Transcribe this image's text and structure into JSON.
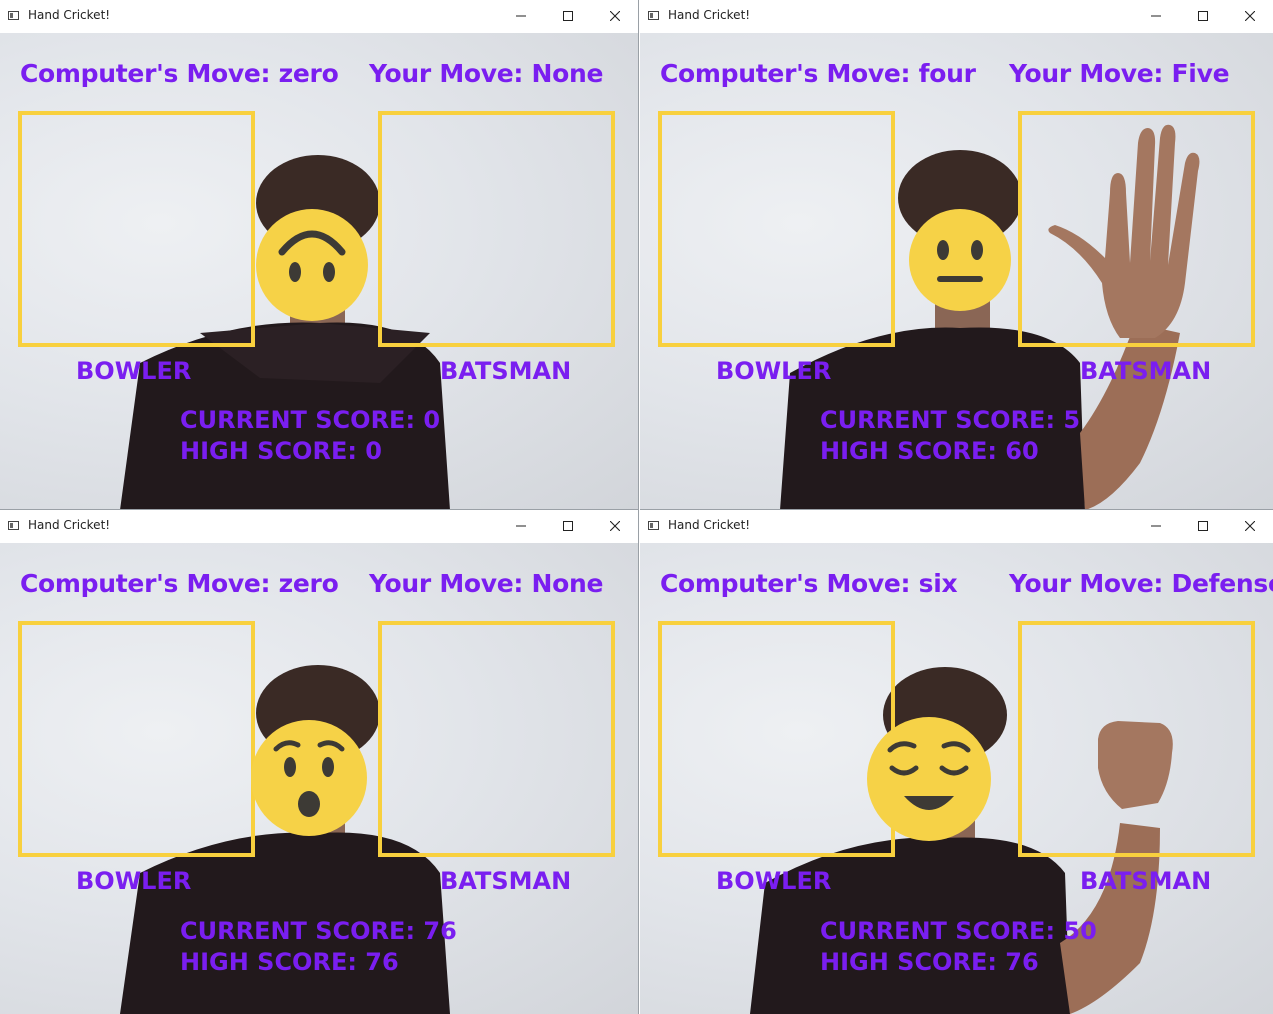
{
  "colors": {
    "hud_text": "#7a1ef0",
    "box_border": "#f8d03e",
    "emoji_face": "#f6d247"
  },
  "windows": [
    {
      "title": "Hand Cricket!",
      "computer_move": "Computer's Move: zero",
      "your_move": "Your Move: None",
      "bowler_label": "BOWLER",
      "batsman_label": "BATSMAN",
      "current_score": "CURRENT SCORE: 0",
      "high_score": "HIGH SCORE: 0",
      "emoji": "upside-down-face-emoji",
      "hand": "none"
    },
    {
      "title": "Hand Cricket!",
      "computer_move": "Computer's Move: four",
      "your_move": "Your Move: Five",
      "bowler_label": "BOWLER",
      "batsman_label": "BATSMAN",
      "current_score": "CURRENT SCORE: 5",
      "high_score": "HIGH SCORE: 60",
      "emoji": "neutral-face-emoji",
      "hand": "open-palm"
    },
    {
      "title": "Hand Cricket!",
      "computer_move": "Computer's Move: zero",
      "your_move": "Your Move: None",
      "bowler_label": "BOWLER",
      "batsman_label": "BATSMAN",
      "current_score": "CURRENT SCORE: 76",
      "high_score": "HIGH SCORE: 76",
      "emoji": "hushed-face-emoji",
      "hand": "none"
    },
    {
      "title": "Hand Cricket!",
      "computer_move": "Computer's Move: six",
      "your_move": "Your Move: Defense",
      "bowler_label": "BOWLER",
      "batsman_label": "BATSMAN",
      "current_score": "CURRENT SCORE: 50",
      "high_score": "HIGH SCORE: 76",
      "emoji": "relieved-face-emoji",
      "hand": "fist"
    }
  ]
}
